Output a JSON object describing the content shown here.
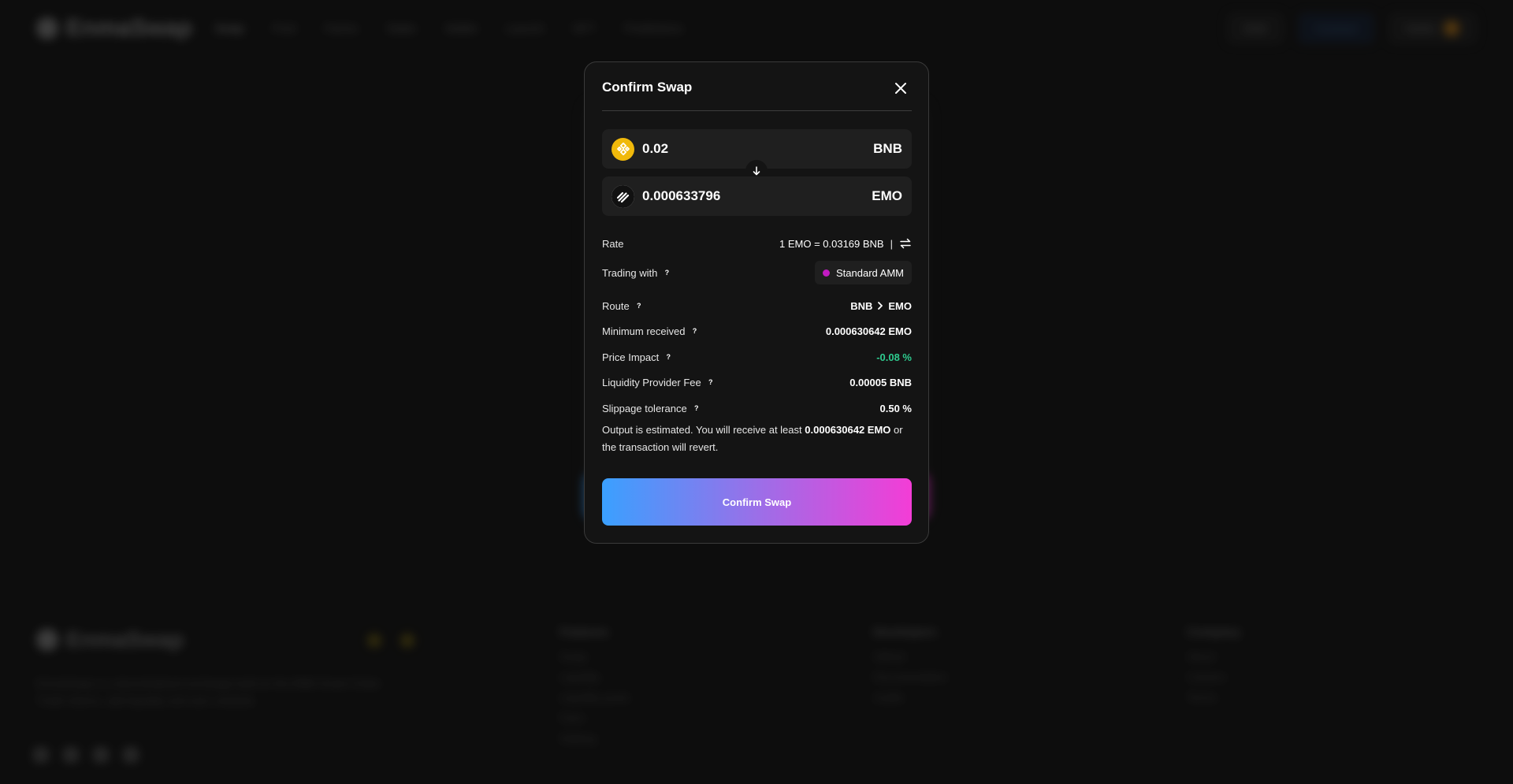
{
  "background": {
    "logo_text": "EnmaSwap",
    "nav_items": [
      "Swap",
      "Pool",
      "Farms",
      "Stake",
      "Wallet",
      "Launch",
      "NFT",
      "Predictions"
    ],
    "header_right": [
      "BNB",
      "Connect",
      "Wallet"
    ],
    "footer": {
      "logo_text": "EnmaSwap",
      "description": "EnmaSwap is a decentralized exchange built on the BNB Smart Chain. Trade tokens, add liquidity and earn rewards.",
      "columns": [
        {
          "heading": "Features",
          "items": [
            "Swap",
            "Liquidity",
            "Liquidity pools",
            "Farm",
            "Staking"
          ]
        },
        {
          "heading": "Developers",
          "items": [
            "Github",
            "Documentation",
            "Audits"
          ]
        },
        {
          "heading": "Company",
          "items": [
            "About",
            "Careers",
            "Terms"
          ]
        }
      ]
    }
  },
  "modal": {
    "title": "Confirm Swap",
    "from": {
      "amount": "0.02",
      "symbol": "BNB"
    },
    "to": {
      "amount": "0.000633796",
      "symbol": "EMO"
    },
    "rate": {
      "label": "Rate",
      "value": "1 EMO = 0.03169 BNB",
      "separator": "|"
    },
    "trading_with": {
      "label": "Trading with",
      "value": "Standard AMM",
      "dot_color": "#c21ac2"
    },
    "route": {
      "label": "Route",
      "from": "BNB",
      "to": "EMO"
    },
    "minimum_received": {
      "label": "Minimum received",
      "value": "0.000630642 EMO"
    },
    "price_impact": {
      "label": "Price Impact",
      "value": "-0.08 %",
      "color": "#2ecc8f"
    },
    "lp_fee": {
      "label": "Liquidity Provider Fee",
      "value": "0.00005 BNB"
    },
    "slippage": {
      "label": "Slippage tolerance",
      "value": "0.50 %"
    },
    "note": {
      "prefix": "Output is estimated. You will receive at least",
      "amount": "0.000630642 EMO",
      "suffix": "or the transaction will revert."
    },
    "help_glyph": "?",
    "confirm_label": "Confirm Swap"
  },
  "colors": {
    "accent_blue": "#3aa0ff",
    "accent_pink": "#f33dd6",
    "bnb_yellow": "#f0b90b",
    "positive_green": "#2ecc8f"
  }
}
